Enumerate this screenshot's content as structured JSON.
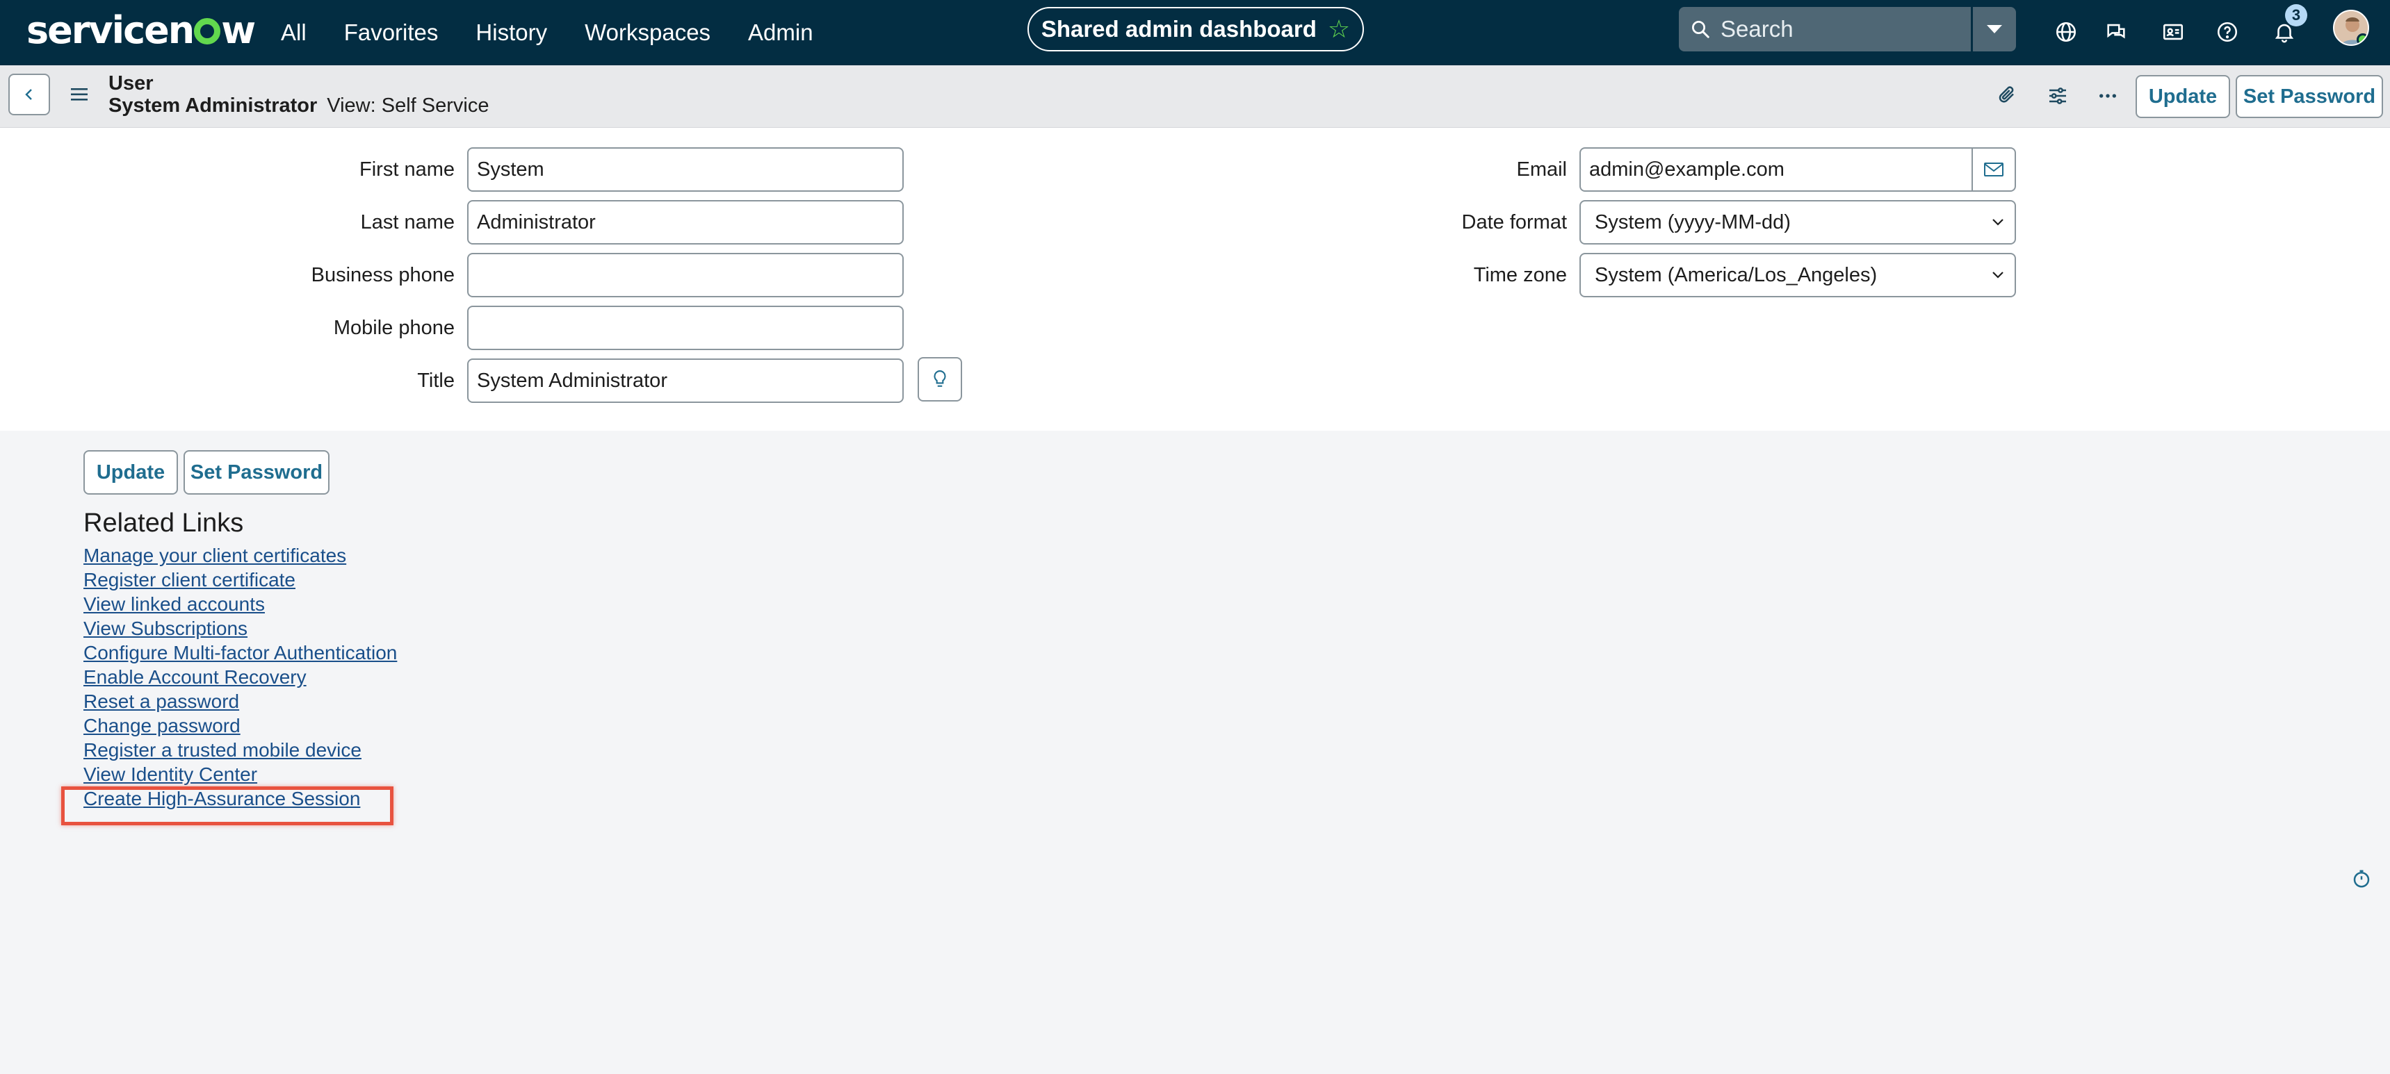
{
  "brand": {
    "logo_text_pre": "servicen",
    "logo_text_post": "w"
  },
  "nav": {
    "items": [
      "All",
      "Favorites",
      "History",
      "Workspaces",
      "Admin"
    ],
    "dashboard_label": "Shared admin dashboard",
    "search_placeholder": "Search",
    "notification_count": "3"
  },
  "header": {
    "record_type": "User",
    "record_name": "System Administrator",
    "view_label": "View: Self Service",
    "update_label": "Update",
    "set_password_label": "Set Password"
  },
  "form": {
    "first_name": {
      "label": "First name",
      "value": "System"
    },
    "last_name": {
      "label": "Last name",
      "value": "Administrator"
    },
    "business_phone": {
      "label": "Business phone",
      "value": ""
    },
    "mobile_phone": {
      "label": "Mobile phone",
      "value": ""
    },
    "title": {
      "label": "Title",
      "value": "System Administrator"
    },
    "email": {
      "label": "Email",
      "value": "admin@example.com"
    },
    "date_format": {
      "label": "Date format",
      "value": "System (yyyy-MM-dd)"
    },
    "time_zone": {
      "label": "Time zone",
      "value": "System (America/Los_Angeles)"
    }
  },
  "bottom": {
    "update_label": "Update",
    "set_password_label": "Set Password",
    "related_links_title": "Related Links",
    "links": [
      "Manage your client certificates",
      "Register client certificate",
      "View linked accounts",
      "View Subscriptions",
      "Configure Multi-factor Authentication",
      "Enable Account Recovery",
      "Reset a password",
      "Change password",
      "Register a trusted mobile device",
      "View Identity Center",
      "Create High-Assurance Session"
    ]
  },
  "colors": {
    "nav_bg": "#032d42",
    "accent_green": "#62d84e",
    "button_text": "#1f6d8f",
    "link": "#1a4f8a",
    "highlight": "#e8523f"
  }
}
